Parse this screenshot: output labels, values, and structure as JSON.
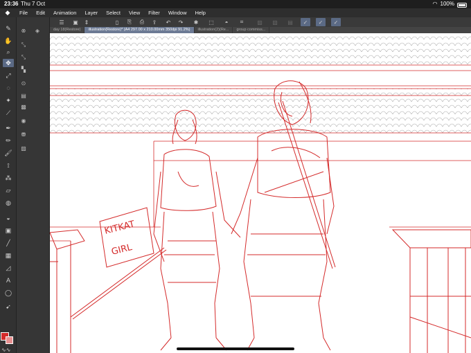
{
  "status": {
    "time": "23:36",
    "date": "Thu 7 Oct",
    "battery": "100%"
  },
  "menu": [
    "File",
    "Edit",
    "Animation",
    "Layer",
    "Select",
    "View",
    "Filter",
    "Window",
    "Help"
  ],
  "tabs": [
    {
      "label": "day 18(Restore)",
      "active": false
    },
    {
      "label": "illustration(Restore)* (A4 297.00 x 210.00mm 350dpi 91.2%)",
      "active": true
    },
    {
      "label": "illustration(2)(Re...",
      "active": false
    },
    {
      "label": "group commiss...",
      "active": false
    }
  ],
  "canvas": {
    "sign_line1": "KITKAT",
    "sign_line2": "GIRL"
  },
  "colors": {
    "main": "#d42a2a",
    "sub": "#e89090",
    "sketch": "#d42a2a",
    "accent": "#5b6a85"
  }
}
